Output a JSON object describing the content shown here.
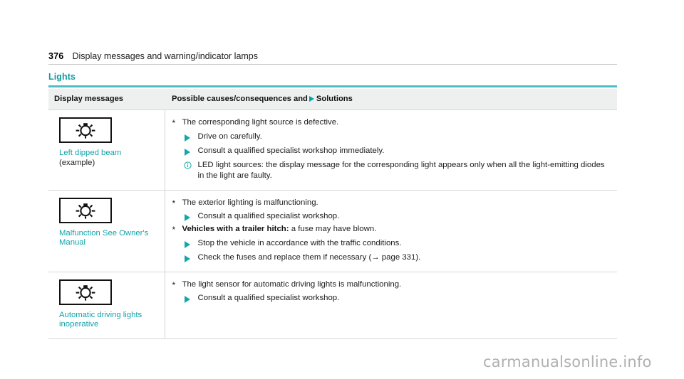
{
  "page": {
    "number": "376",
    "running_title": "Display messages and warning/indicator lamps",
    "section_title": "Lights",
    "watermark": "carmanualsonline.info",
    "accent_color": "#0fa3a9",
    "rule_color": "#4cbec4",
    "marker_color": "#12a7ab"
  },
  "table": {
    "headers": {
      "display_messages": "Display messages",
      "causes_prefix": "Possible causes/consequences and",
      "causes_marker": "solutions-triangle-icon",
      "causes_suffix": "Solutions"
    },
    "rows": [
      {
        "icon": "dipped-beam-lamp-icon",
        "label": "Left dipped beam",
        "label_suffix": " (example)",
        "items": [
          {
            "type": "cause",
            "text": "The corresponding light source is defective.",
            "steps": [
              "Drive on carefully.",
              "Consult a qualified specialist workshop immediately."
            ],
            "notes": [
              "LED light sources: the display message for the corresponding light appears only when all the light-emitting diodes in the light are faulty."
            ]
          }
        ]
      },
      {
        "icon": "dipped-beam-lamp-icon",
        "label": "Malfunction See Owner's Manual",
        "label_suffix": "",
        "items": [
          {
            "type": "cause",
            "text": "The exterior lighting is malfunctioning.",
            "steps": [
              "Consult a qualified specialist workshop."
            ],
            "notes": []
          },
          {
            "type": "cause",
            "lead": "Vehicles with a trailer hitch:",
            "text": " a fuse may have blown.",
            "steps": [
              "Stop the vehicle in accordance with the traffic conditions.",
              "Check the fuses and replace them if necessary (→ page 331)."
            ],
            "notes": []
          }
        ]
      },
      {
        "icon": "dipped-beam-lamp-icon",
        "label": "Automatic driving lights inoperative",
        "label_suffix": "",
        "items": [
          {
            "type": "cause",
            "text": "The light sensor for automatic driving lights is malfunctioning.",
            "steps": [
              "Consult a qualified specialist workshop."
            ],
            "notes": []
          }
        ]
      }
    ]
  }
}
